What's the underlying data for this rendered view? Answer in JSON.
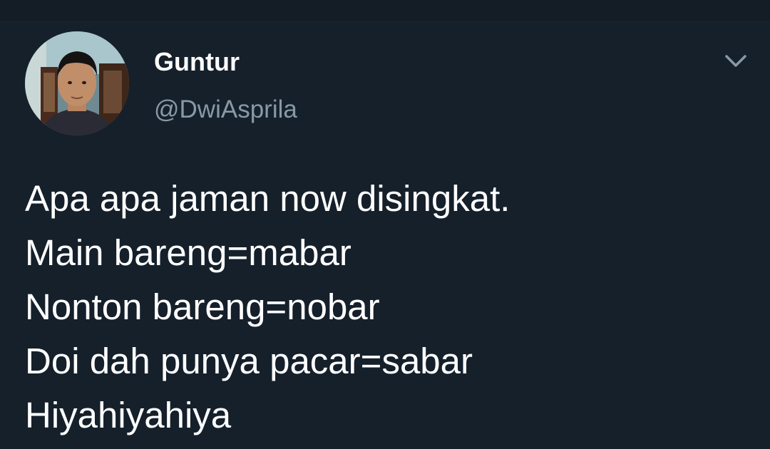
{
  "user": {
    "display_name": "Guntur",
    "handle": "@DwiAsprila"
  },
  "tweet": {
    "lines": [
      "Apa apa jaman now disingkat.",
      "Main bareng=mabar",
      "Nonton bareng=nobar",
      "Doi dah punya pacar=sabar",
      "Hiyahiyahiya"
    ]
  },
  "icons": {
    "menu": "chevron-down-icon",
    "avatar": "profile-photo"
  },
  "colors": {
    "background": "#15202b",
    "text": "#ffffff",
    "secondary_text": "#8899a6"
  }
}
